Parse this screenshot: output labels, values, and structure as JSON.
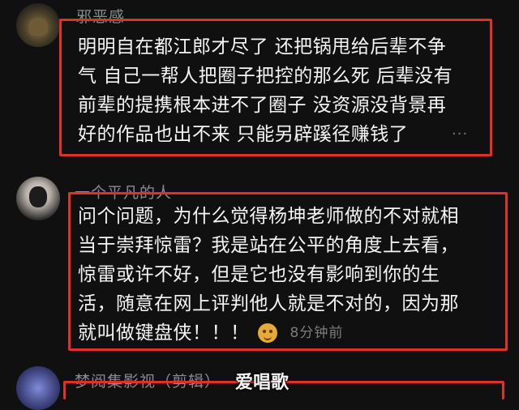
{
  "comments": [
    {
      "username": "邪恶感",
      "lines": [
        "明明自在都江郎才尽了 还把锅甩给后辈不争",
        "气 自己一帮人把圈子把控的那么死 后辈没有",
        "前辈的提携根本进不了圈子 没资源没背景再",
        "好的作品也出不来 只能另辟蹊径赚钱了"
      ],
      "more_glyph": "..."
    },
    {
      "username": "一个平凡的人",
      "lines": [
        "问个问题，为什么觉得杨坤老师做的不对就相",
        "当于崇拜惊雷？我是站在公平的角度上去看，",
        "惊雷或许不好，但是它也没有影响到你的生",
        "活，随意在网上评判他人就是不对的，因为那",
        "就叫做键盘侠！！！"
      ],
      "emoji": "smiling-face-icon",
      "timestamp": "8分钟前"
    },
    {
      "username": "梦阅集影视（剪辑）"
    }
  ],
  "watermark": "爱唱歌",
  "colors": {
    "background": "#101010",
    "highlight_border": "#e0302a",
    "username": "#8b8b8b",
    "comment_text": "#f5f5f5",
    "timestamp": "#7c7c7c"
  }
}
